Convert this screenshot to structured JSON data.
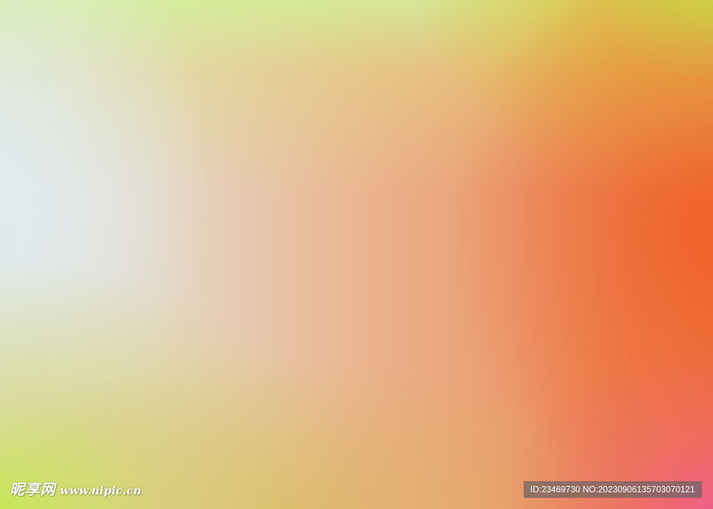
{
  "background": {
    "colors": {
      "left": "#dfe9ea",
      "top_right": "#c4e846",
      "right": "#ef6a33",
      "bottom_right": "#f05f8c",
      "bottom_left": "#c8e650"
    }
  },
  "watermark": {
    "brand": "昵享网",
    "url": "www.nipic.cn"
  },
  "id_badge": {
    "id_label": "ID:23469730",
    "no_label": "NO:20230906135703070121"
  }
}
